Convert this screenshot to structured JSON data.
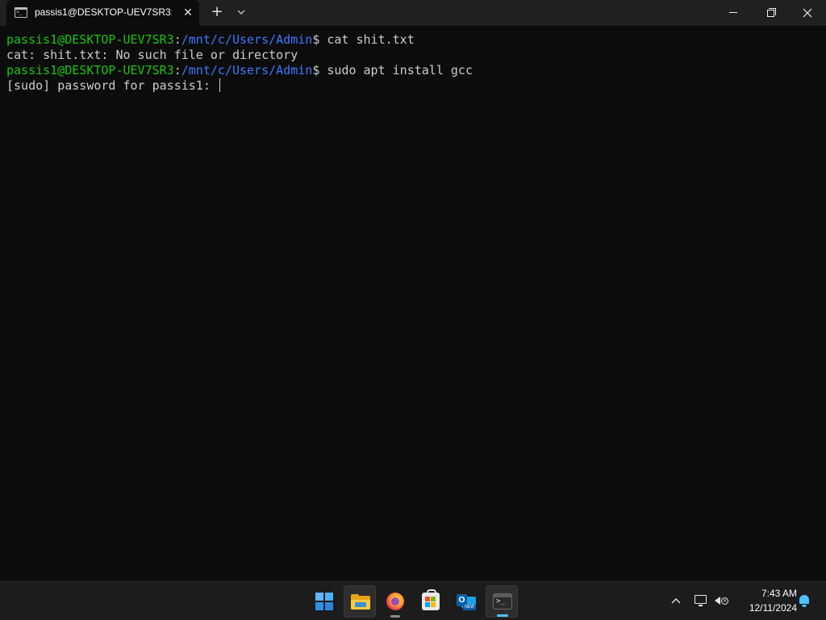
{
  "window": {
    "tab_title": "passis1@DESKTOP-UEV7SR3: ,",
    "tab_icon": "terminal-icon",
    "close_tab": "✕",
    "new_tab": "+",
    "dropdown": "⌄"
  },
  "terminal": {
    "lines": [
      {
        "user": "passis1@DESKTOP-UEV7SR3",
        "sep": ":",
        "path": "/mnt/c/Users/Admin",
        "prompt": "$ ",
        "command": "cat shit.txt"
      },
      {
        "text": "cat: shit.txt: No such file or directory"
      },
      {
        "user": "passis1@DESKTOP-UEV7SR3",
        "sep": ":",
        "path": "/mnt/c/Users/Admin",
        "prompt": "$ ",
        "command": "sudo apt install gcc"
      },
      {
        "text": "[sudo] password for passis1: "
      }
    ],
    "colors": {
      "user": "#16c60c",
      "path": "#3b78ff",
      "text": "#cccccc",
      "background": "#0c0c0c"
    }
  },
  "taskbar": {
    "apps": [
      "start",
      "file-explorer",
      "firefox",
      "microsoft-store",
      "outlook-new",
      "terminal"
    ],
    "outlook_badge": "NEW",
    "terminal_glyph": ">_",
    "tray_chevron": "^",
    "clock": {
      "time": "7:43 AM",
      "date": "12/11/2024"
    },
    "accent": "#4cc2ff"
  }
}
